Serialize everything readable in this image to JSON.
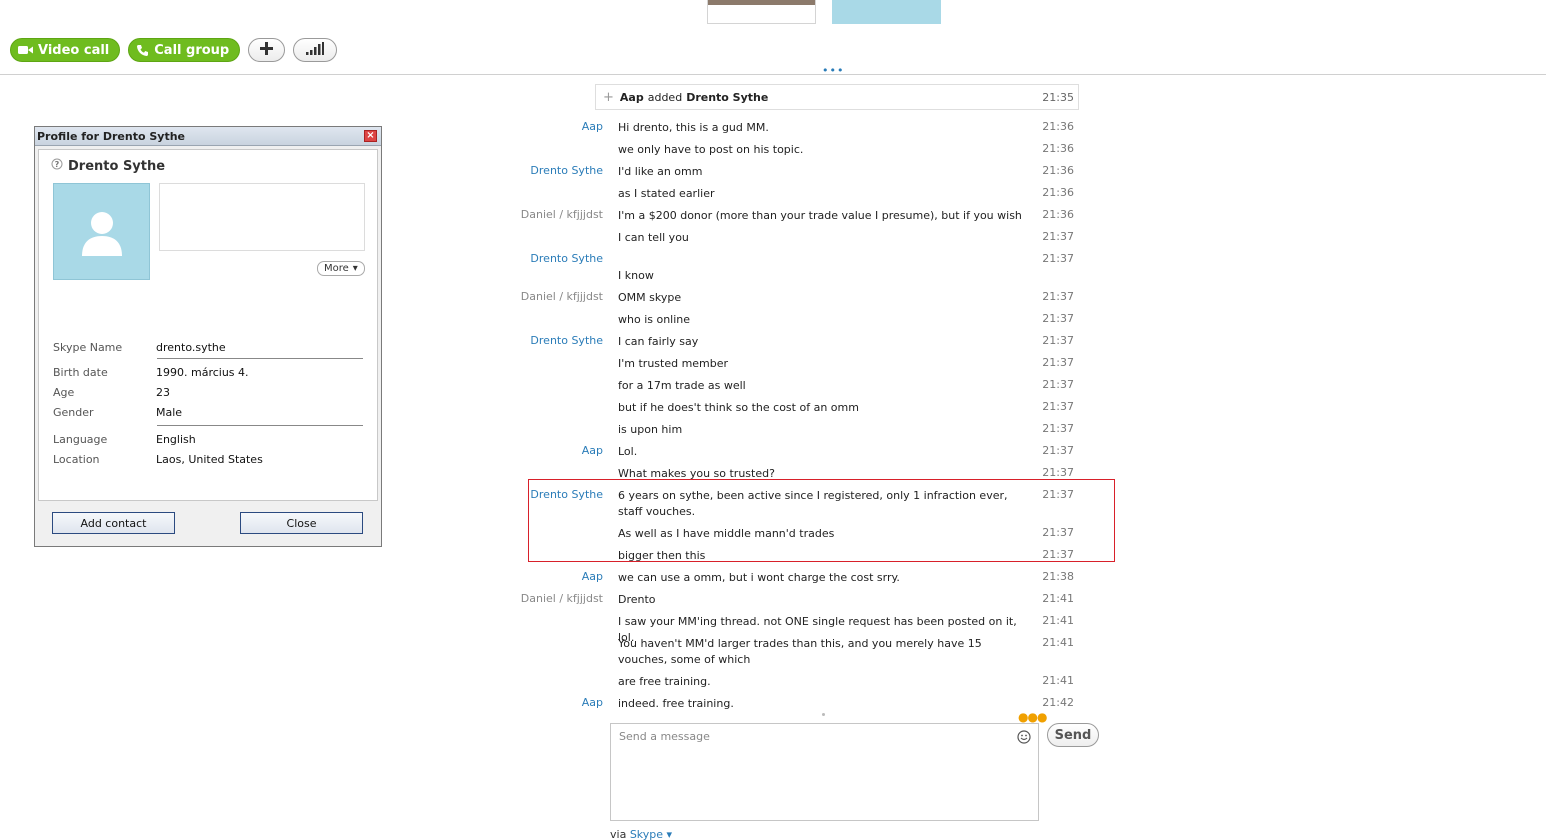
{
  "toolbar": {
    "video_call_label": "Video call",
    "call_group_label": "Call group"
  },
  "profile": {
    "title": "Profile for Drento Sythe",
    "name": "Drento Sythe",
    "more_label": "More",
    "fields": [
      {
        "key": "Skype Name",
        "value": "drento.sythe"
      },
      {
        "key": "Birth date",
        "value": "1990. március 4."
      },
      {
        "key": "Age",
        "value": "23"
      },
      {
        "key": "Gender",
        "value": "Male"
      },
      {
        "key": "Language",
        "value": "English"
      },
      {
        "key": "Location",
        "value": "Laos, United States"
      }
    ],
    "add_contact_label": "Add contact",
    "close_label": "Close"
  },
  "chat": {
    "system": {
      "actor": "Aap",
      "verb": "added",
      "target": "Drento Sythe",
      "time": "21:35"
    },
    "messages": [
      {
        "sender": "Aap",
        "color": "blue",
        "text": "Hi drento, this is a gud MM.",
        "time": "21:36"
      },
      {
        "sender": "",
        "color": "",
        "text": "we only have to post on his topic.",
        "time": "21:36"
      },
      {
        "sender": "Drento Sythe",
        "color": "blue",
        "text": "I'd like an omm",
        "time": "21:36"
      },
      {
        "sender": "",
        "color": "",
        "text": "as I stated earlier",
        "time": "21:36"
      },
      {
        "sender": "Daniel / kfjjjdst",
        "color": "gray",
        "text": "I'm a $200 donor (more than your trade value I presume), but if you wish",
        "time": "21:36"
      },
      {
        "sender": "",
        "color": "",
        "text": "I can tell you",
        "time": "21:37"
      },
      {
        "sender": "Drento Sythe",
        "color": "blue",
        "text": "",
        "time": "21:37"
      },
      {
        "sender": "",
        "color": "",
        "text": "I know",
        "time": ""
      },
      {
        "sender": "Daniel / kfjjjdst",
        "color": "gray",
        "text": "OMM skype",
        "time": "21:37"
      },
      {
        "sender": "",
        "color": "",
        "text": "who is online",
        "time": "21:37"
      },
      {
        "sender": "Drento Sythe",
        "color": "blue",
        "text": "I can fairly say",
        "time": "21:37"
      },
      {
        "sender": "",
        "color": "",
        "text": "I'm trusted member",
        "time": "21:37"
      },
      {
        "sender": "",
        "color": "",
        "text": "for a 17m trade as well",
        "time": "21:37"
      },
      {
        "sender": "",
        "color": "",
        "text": "but if he does't think so the cost of an omm",
        "time": "21:37"
      },
      {
        "sender": "",
        "color": "",
        "text": "is upon him",
        "time": "21:37"
      },
      {
        "sender": "Aap",
        "color": "blue",
        "text": "Lol.",
        "time": "21:37"
      },
      {
        "sender": "",
        "color": "",
        "text": "What makes you so trusted?",
        "time": "21:37"
      },
      {
        "sender": "Drento Sythe",
        "color": "blue",
        "text": "6 years on sythe, been active since I registered, only 1 infraction ever, staff vouches.",
        "time": "21:37"
      },
      {
        "sender": "",
        "color": "",
        "text": "As well as I have middle mann'd trades",
        "time": "21:37"
      },
      {
        "sender": "",
        "color": "",
        "text": "bigger then this",
        "time": "21:37"
      },
      {
        "sender": "Aap",
        "color": "blue",
        "text": "we can use a omm, but i wont charge the cost srry.",
        "time": "21:38"
      },
      {
        "sender": "Daniel / kfjjjdst",
        "color": "gray",
        "text": "Drento",
        "time": "21:41"
      },
      {
        "sender": "",
        "color": "",
        "text": "I saw your MM'ing thread. not ONE single request has been posted on it, lol.",
        "time": "21:41"
      },
      {
        "sender": "",
        "color": "",
        "text": "You haven't MM'd larger trades than this, and you merely have 15 vouches, some of which",
        "time": "21:41"
      },
      {
        "sender": "",
        "color": "",
        "text": "are free training.",
        "time": "21:41"
      },
      {
        "sender": "Aap",
        "color": "blue",
        "text": "indeed. free training.",
        "time": "21:42"
      }
    ]
  },
  "compose": {
    "placeholder": "Send a message",
    "send_label": "Send",
    "via_prefix": "via",
    "via_app": "Skype"
  }
}
